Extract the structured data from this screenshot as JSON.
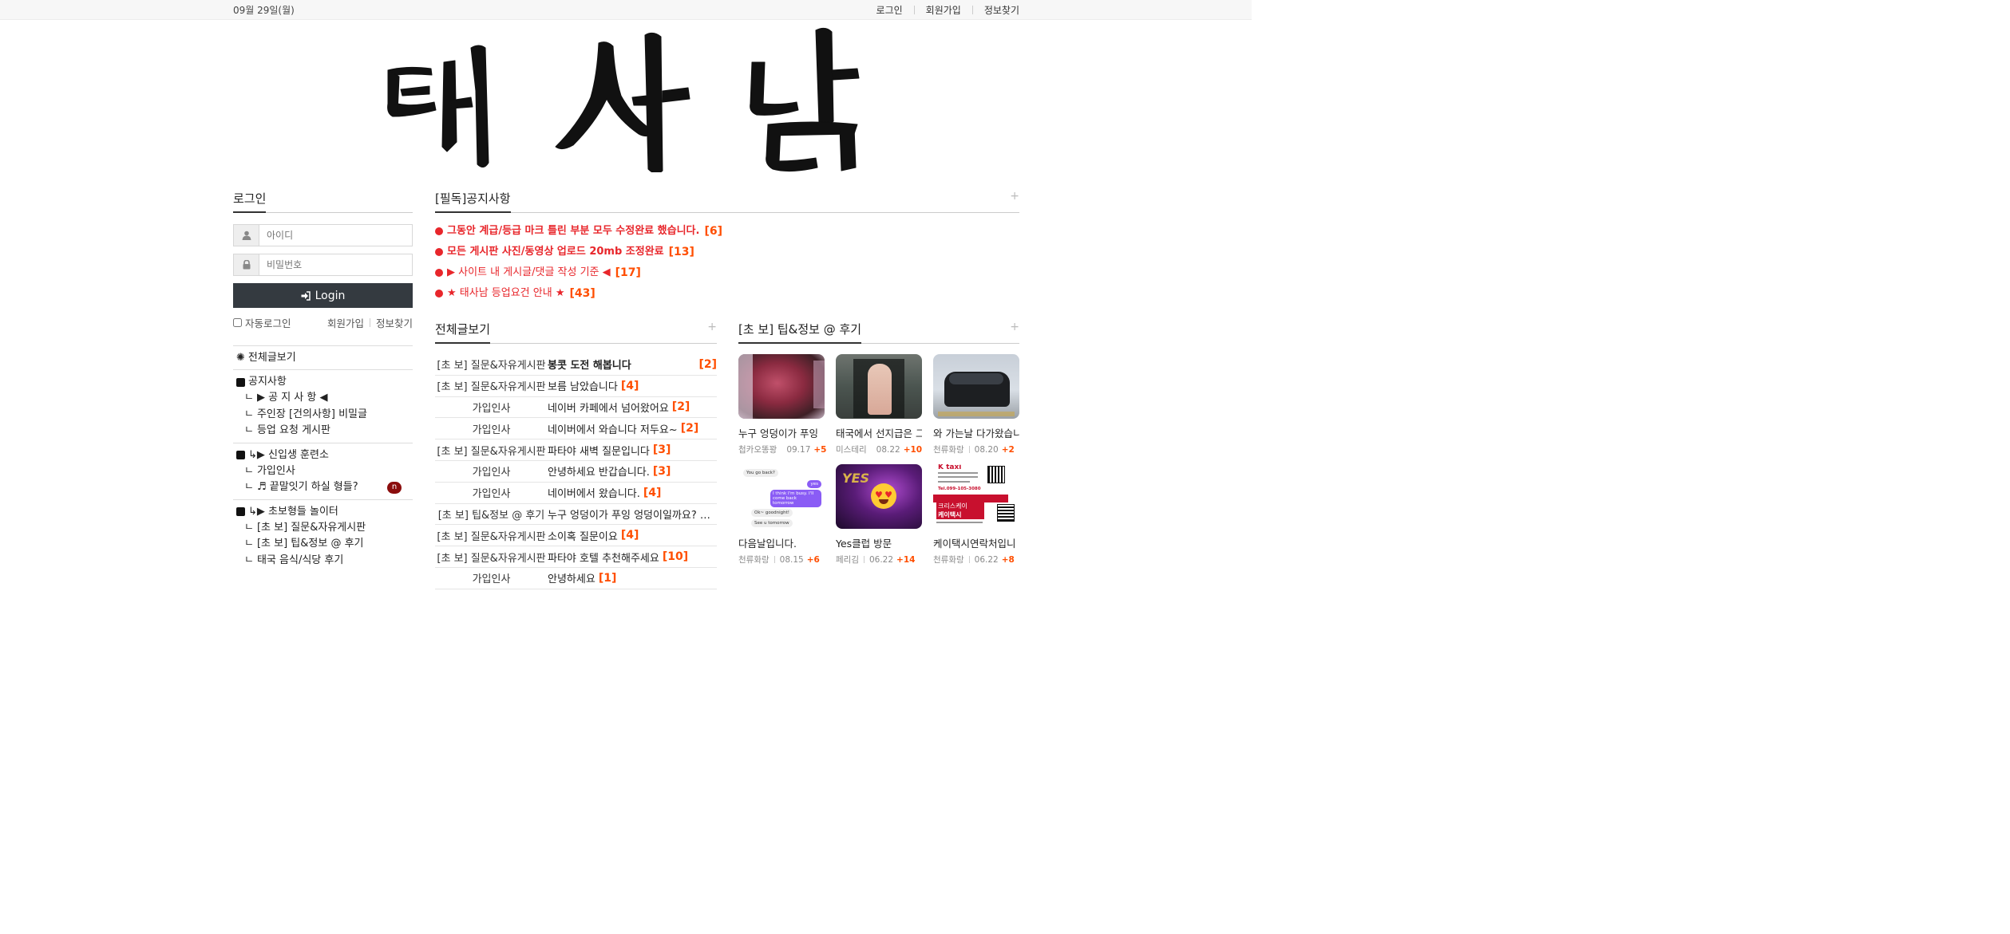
{
  "top_bar": {
    "date": "09월 29일(월)",
    "links": [
      "로그인",
      "회원가입",
      "정보찾기"
    ]
  },
  "logo": {
    "text": "태사남"
  },
  "login": {
    "title": "로그인",
    "id_placeholder": "아이디",
    "password_placeholder": "비밀번호",
    "login_button": "Login",
    "auto_login": "자동로그인",
    "join_link": "회원가입",
    "find_link": "정보찾기"
  },
  "nav": {
    "all": "전체글보기",
    "notice_group": "공지사항",
    "notice_items": [
      "▶ 공 지 사 항 ◀",
      "주인장 [건의사항] 비밀글",
      "등업 요청 게시판"
    ],
    "newbie_group": "↳▶ 신입생 훈련소",
    "newbie_items": [
      "가입인사",
      "♬ 끝말잇기 하실 형들?"
    ],
    "newbie_badge": "n",
    "beginner_group": "↳▶ 초보형들 놀이터",
    "beginner_items": [
      "[초 보] 질문&자유게시판",
      "[초 보] 팁&정보 @ 후기",
      "태국 음식/식당 후기"
    ]
  },
  "notice": {
    "title": "[필독]공지사항",
    "items": [
      {
        "text": "그동안 계급/등급 마크 틀린 부분 모두 수정완료 했습니다.",
        "count": "[6]",
        "bold": true
      },
      {
        "text": "모든 게시판 사진/동영상 업로드 20mb 조정완료",
        "count": "[13]",
        "bold": true
      },
      {
        "text": "▶ 사이트 내 게시글/댓글 작성 기준 ◀",
        "count": "[17]",
        "bold": false
      },
      {
        "text": "★ 태사남 등업요건 안내 ★",
        "count": "[43]",
        "bold": false
      }
    ]
  },
  "all_posts": {
    "title": "전체글보기",
    "rows": [
      {
        "category": "[초 보] 질문&자유게시판",
        "title": "봉콧 도전 해봅니다",
        "count": "[2]",
        "bold": true
      },
      {
        "category": "[초 보] 질문&자유게시판",
        "title": "보름 남았습니다",
        "count": "[4]",
        "bold": false
      },
      {
        "category": "가입인사",
        "title": "네이버 카페에서 넘어왔어요",
        "count": "[2]",
        "bold": false
      },
      {
        "category": "가입인사",
        "title": "네이버에서 와습니다 저두요~",
        "count": "[2]",
        "bold": false
      },
      {
        "category": "[초 보] 질문&자유게시판",
        "title": "파타야 새벽 질문입니다",
        "count": "[3]",
        "bold": false
      },
      {
        "category": "가입인사",
        "title": "안녕하세요 반갑습니다.",
        "count": "[3]",
        "bold": false
      },
      {
        "category": "가입인사",
        "title": "네이버에서 왔습니다.",
        "count": "[4]",
        "bold": false
      },
      {
        "category": "[초 보] 팁&정보 @ 후기",
        "title": "누구 엉덩이가 푸잉 엉덩이일까요? 맞춰보세요",
        "count": "",
        "bold": false
      },
      {
        "category": "[초 보] 질문&자유게시판",
        "title": "소이혹 질문이요",
        "count": "[4]",
        "bold": false
      },
      {
        "category": "[초 보] 질문&자유게시판",
        "title": "파타야 호텔 추천해주세요",
        "count": "[10]",
        "bold": false
      },
      {
        "category": "가입인사",
        "title": "안녕하세요",
        "count": "[1]",
        "bold": false
      }
    ]
  },
  "tips": {
    "title": "[초 보] 팁&정보 @ 후기",
    "cards": [
      {
        "caption": "누구 엉덩이가 푸잉",
        "author": "첩카오똥꽝",
        "date": "09.17",
        "count": "+5",
        "thumb": "thumb-1"
      },
      {
        "caption": "태국에서 선지급은 그",
        "author": "미스테리",
        "date": "08.22",
        "count": "+10",
        "thumb": "thumb-2"
      },
      {
        "caption": "와 가는날 다가왔습니",
        "author": "천류화랑",
        "date": "08.20",
        "count": "+2",
        "thumb": "thumb-3"
      },
      {
        "caption": "다음날입니다.",
        "author": "천류화랑",
        "date": "08.15",
        "count": "+6",
        "thumb": "thumb-4"
      },
      {
        "caption": "Yes클럽 방문",
        "author": "페리김",
        "date": "06.22",
        "count": "+14",
        "thumb": "thumb-5"
      },
      {
        "caption": "케이택시연락처입니",
        "author": "천류화랑",
        "date": "06.22",
        "count": "+8",
        "thumb": "thumb-6"
      }
    ],
    "chat": {
      "msg1": "You go back?",
      "msg2": "yes",
      "msg3": "I think I'm busy. I'll come back tomorrow",
      "msg4": "Ok~ goodnight!",
      "msg5": "See u tomorrow"
    },
    "club_sign": "YES",
    "taxi": {
      "brand": "K taxi",
      "tel": "Tel.099-105-3080",
      "name_en": "크리스케이",
      "name_ko": "케이택시"
    }
  },
  "colors": {
    "accent_red": "#e8262b",
    "count_orange": "#ff4e00",
    "button_dark": "#343a40",
    "badge": "#8b0d0d"
  }
}
